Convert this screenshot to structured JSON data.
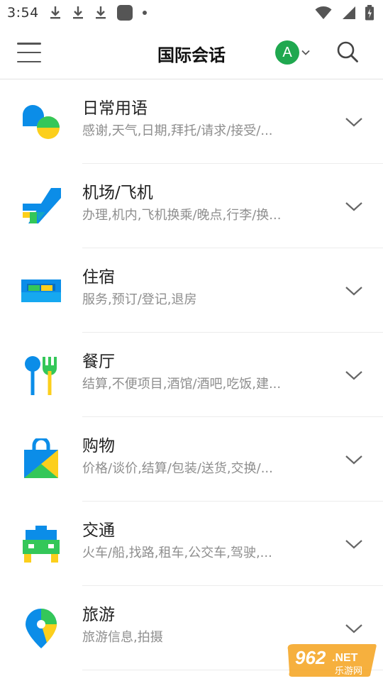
{
  "status_bar": {
    "time": "3:54",
    "left_icons": [
      "download-icon",
      "download-icon",
      "download-icon",
      "app-square-icon",
      "dot-icon"
    ],
    "right_icons": [
      "wifi-icon",
      "signal-icon",
      "battery-icon"
    ]
  },
  "app_bar": {
    "title": "国际会话",
    "avatar_letter": "A",
    "avatar_color": "#1fa84f"
  },
  "categories": [
    {
      "title": "日常用语",
      "subtitle": "感谢,天气,日期,拜托/请求/接受/...",
      "icon": "chat-bubbles-icon"
    },
    {
      "title": "机场/飞机",
      "subtitle": "办理,机内,飞机换乘/晚点,行李/换...",
      "icon": "airplane-icon"
    },
    {
      "title": "住宿",
      "subtitle": "服务,预订/登记,退房",
      "icon": "bed-icon"
    },
    {
      "title": "餐厅",
      "subtitle": "结算,不便项目,酒馆/酒吧,吃饭,建...",
      "icon": "utensils-icon"
    },
    {
      "title": "购物",
      "subtitle": "价格/谈价,结算/包装/送货,交换/...",
      "icon": "shopping-bag-icon"
    },
    {
      "title": "交通",
      "subtitle": "火车/船,找路,租车,公交车,驾驶,...",
      "icon": "vehicle-icon"
    },
    {
      "title": "旅游",
      "subtitle": "旅游信息,拍摄",
      "icon": "map-pin-icon"
    }
  ],
  "watermark": {
    "number": "962",
    "suffix": ".NET",
    "caption": "乐游网"
  },
  "colors": {
    "blue": "#0b8de8",
    "yellow": "#fccf1c",
    "green": "#34c759",
    "teal": "#14a6c4"
  }
}
